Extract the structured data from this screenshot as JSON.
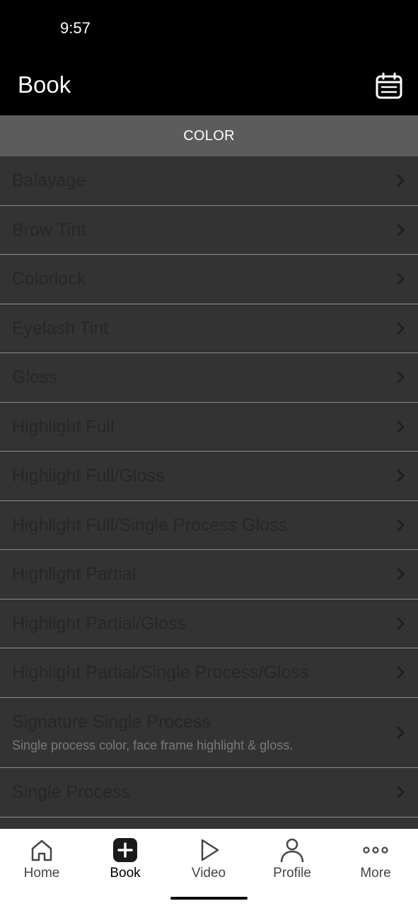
{
  "status_bar": {
    "time": "9:57"
  },
  "header": {
    "title": "Book",
    "calendar_icon": "calendar-icon"
  },
  "section": {
    "title": "COLOR"
  },
  "services": [
    {
      "name": "Balayage",
      "description": ""
    },
    {
      "name": "Brow Tint",
      "description": ""
    },
    {
      "name": "Colorlock",
      "description": ""
    },
    {
      "name": "Eyelash Tint",
      "description": ""
    },
    {
      "name": "Gloss",
      "description": ""
    },
    {
      "name": "Highlight Full",
      "description": ""
    },
    {
      "name": "Highlight Full/Gloss",
      "description": ""
    },
    {
      "name": "Highlight Full/Single Process Gloss",
      "description": ""
    },
    {
      "name": "Highlight Partial",
      "description": ""
    },
    {
      "name": "Highlight Partial/Gloss",
      "description": ""
    },
    {
      "name": "Highlight Partial/Single Process/Gloss",
      "description": ""
    },
    {
      "name": "Signature Single Process",
      "description": "Single process color, face frame highlight & gloss."
    },
    {
      "name": "Single Process",
      "description": ""
    }
  ],
  "tabs": [
    {
      "label": "Home",
      "icon": "home-icon",
      "active": false
    },
    {
      "label": "Book",
      "icon": "plus-icon",
      "active": true
    },
    {
      "label": "Video",
      "icon": "play-icon",
      "active": false
    },
    {
      "label": "Profile",
      "icon": "person-icon",
      "active": false
    },
    {
      "label": "More",
      "icon": "more-icon",
      "active": false
    }
  ],
  "colors": {
    "header_bg": "#000000",
    "section_bg": "#5c5c5c",
    "list_bg": "#333333",
    "tab_bar_bg": "#ffffff"
  }
}
